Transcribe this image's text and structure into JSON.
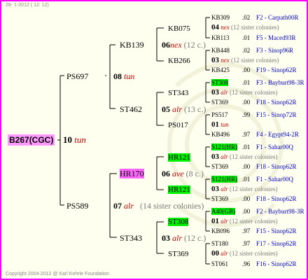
{
  "header": "28-  1-2012 ( 12: 12)",
  "footer": "Copyright 2004-2012 @ Karl Kehrle Foundation",
  "root": "B267(CGC)",
  "g1": [
    {
      "gen": "10",
      "note": "tun"
    }
  ],
  "g2": [
    {
      "id": "PS697",
      "gen": "08",
      "note": "tun"
    },
    {
      "id": "PS589",
      "gen": "07",
      "note": "alr",
      "colonies": "(14 sister colonies)"
    }
  ],
  "g3": [
    {
      "id": "KB139",
      "gen": "06",
      "note": "nex",
      "colonies": "(12 c.)"
    },
    {
      "id": "ST462",
      "gen": "05",
      "note": "alr",
      "colonies": "(13 c.)"
    },
    {
      "id": "HR170",
      "gen": "06",
      "note": "ave",
      "colonies": "(8 c.)"
    },
    {
      "id": "ST343",
      "gen": "03",
      "note": "alr",
      "colonies": "(12 c.)"
    }
  ],
  "g4": [
    {
      "id": "KB075",
      "gen": "04",
      "note": "nex",
      "colonies": "(12 sister colonies)"
    },
    {
      "id": "KB266",
      "gen": "03",
      "note": "nex",
      "colonies": "(12 sister colonies)"
    },
    {
      "id": "ST343",
      "gen": "03",
      "note": "alr",
      "colonies": "(12 sister colonies)"
    },
    {
      "id": "PS017",
      "gen": "01",
      "note": "tun",
      "colonies": ""
    },
    {
      "id": "HR121",
      "gen": "03",
      "note": "alr",
      "colonies": "(12 sister colonies)"
    },
    {
      "id": "HR121",
      "gen": "03",
      "note": "alr",
      "colonies": "(12 sister colonies)"
    },
    {
      "id": "ST308",
      "gen": "01",
      "note": "alr",
      "colonies": "(12 sister colonies)"
    },
    {
      "id": "ST369",
      "gen": "00",
      "note": "alr",
      "colonies": "(12 sister colonies)"
    }
  ],
  "g5": [
    {
      "id": "KB309",
      "year": ".02",
      "origin": "F2 - Carpath00R"
    },
    {
      "id": "KB113",
      "year": ".01",
      "origin": "F5 - Maced93R"
    },
    {
      "id": "KB448",
      "year": ".02",
      "origin": "F3 - Sinop96R"
    },
    {
      "id": "KB425",
      "year": ".00",
      "origin": "F19 - Sinop62R"
    },
    {
      "id": "ST308",
      "year": ".01",
      "origin": "F3 - Bayburt98-3R"
    },
    {
      "id": "ST369",
      "year": ".00",
      "origin": "F18 - Sinop62R"
    },
    {
      "id": "PS517",
      "year": ".99",
      "origin": "F15 - Sinop72R"
    },
    {
      "id": "KB496",
      "year": ".97",
      "origin": "F4 - Egypt94-2R"
    },
    {
      "id": "S121(HR)",
      "year": ".01",
      "origin": "F1 - Sahar00Q"
    },
    {
      "id": "ST369",
      "year": ".00",
      "origin": "F18 - Sinop62R"
    },
    {
      "id": "S121(HR)",
      "year": ".01",
      "origin": "F1 - Sahar00Q"
    },
    {
      "id": "ST369",
      "year": ".00",
      "origin": "F18 - Sinop62R"
    },
    {
      "id": "A40(GB)",
      "year": ".00",
      "origin": "F2 - Bayburt98-3R"
    },
    {
      "id": "KB096",
      "year": ".97",
      "origin": "F15 - Sinop62R"
    },
    {
      "id": "ST180",
      "year": ".97",
      "origin": "F17 - Sinop62R"
    },
    {
      "id": "ST061",
      "year": ".96",
      "origin": "F16 - Sinop62R"
    }
  ]
}
